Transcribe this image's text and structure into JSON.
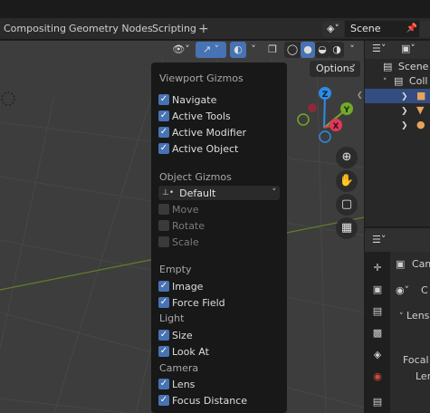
{
  "workspace_tabs": [
    "Compositing",
    "Geometry Nodes",
    "Scripting"
  ],
  "add_workspace": "+",
  "scene": {
    "name": "Scene"
  },
  "viewport_header": {
    "options_label": "Options"
  },
  "gizmo_popup": {
    "viewport_gizmos_title": "Viewport Gizmos",
    "viewport_gizmos": [
      {
        "label": "Navigate",
        "checked": true
      },
      {
        "label": "Active Tools",
        "checked": true
      },
      {
        "label": "Active Modifier",
        "checked": true
      },
      {
        "label": "Active Object",
        "checked": true
      }
    ],
    "object_gizmos_title": "Object Gizmos",
    "orientation_value": "Default",
    "object_gizmos": [
      {
        "label": "Move",
        "checked": false
      },
      {
        "label": "Rotate",
        "checked": false
      },
      {
        "label": "Scale",
        "checked": false
      }
    ],
    "empty_title": "Empty",
    "empty": [
      {
        "label": "Image",
        "checked": true
      },
      {
        "label": "Force Field",
        "checked": true
      }
    ],
    "light_title": "Light",
    "light": [
      {
        "label": "Size",
        "checked": true
      },
      {
        "label": "Look At",
        "checked": true
      }
    ],
    "camera_title": "Camera",
    "camera": [
      {
        "label": "Lens",
        "checked": true
      },
      {
        "label": "Focus Distance",
        "checked": true
      }
    ]
  },
  "nav_gizmo": {
    "z": "Z",
    "y": "Y",
    "x": "X"
  },
  "outliner": {
    "scene_collection": "Scene C",
    "collection": "Coll"
  },
  "properties": {
    "cam_label": "Cam",
    "c_label": "C",
    "lens_section": "Lens",
    "focal_label": "Focal L",
    "lens_label": "Len"
  },
  "colors": {
    "accent": "#4772b3",
    "axis_x": "#e0385a",
    "axis_y": "#74a82a",
    "axis_z": "#2d8ce6"
  }
}
